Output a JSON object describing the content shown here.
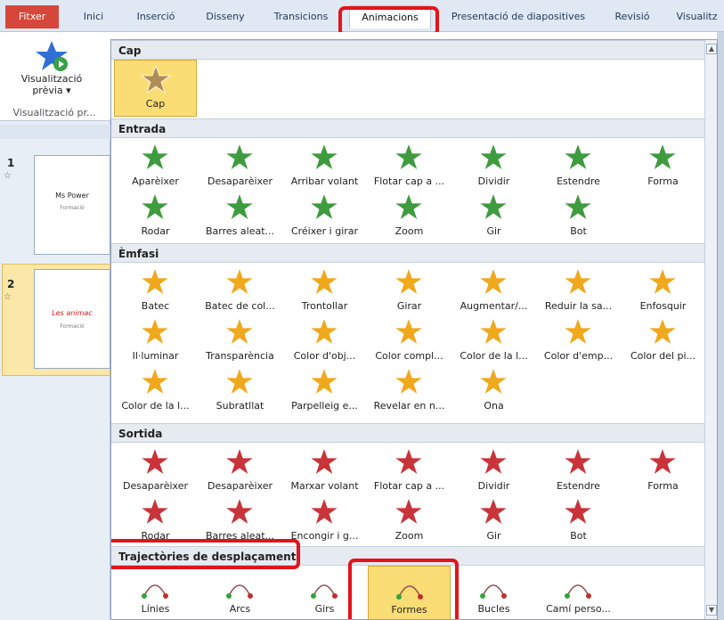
{
  "tabs": [
    "Fitxer",
    "Inici",
    "Inserció",
    "Disseny",
    "Transicions",
    "Animacions",
    "Presentació de diapositives",
    "Revisió",
    "Visualitz"
  ],
  "ribbon": {
    "preview_line1": "Visualització",
    "preview_line2": "prèvia ▾",
    "group": "Visualització pr..."
  },
  "slides": [
    {
      "num": "1",
      "title": "Ms Power",
      "sub": "Formació"
    },
    {
      "num": "2",
      "title": "Les animac",
      "sub": "Formació"
    }
  ],
  "sections": {
    "cap": "Cap",
    "entrada": "Entrada",
    "emfasi": "Èmfasi",
    "sortida": "Sortida",
    "trajectories": "Trajectòries de desplaçament"
  },
  "items": {
    "cap": [
      "Cap"
    ],
    "entrada": [
      "Aparèixer",
      "Desaparèixer",
      "Arribar volant",
      "Flotar cap a ...",
      "Dividir",
      "Estendre",
      "Forma",
      "Rodar",
      "Barres aleat...",
      "Créixer i girar",
      "Zoom",
      "Gir",
      "Bot"
    ],
    "emfasi": [
      "Batec",
      "Batec de col...",
      "Trontollar",
      "Girar",
      "Augmentar/...",
      "Reduir la sa...",
      "Enfosquir",
      "Il·luminar",
      "Transparència",
      "Color d'obj...",
      "Color compl...",
      "Color de la l...",
      "Color d'emp...",
      "Color del pi...",
      "Color de la l...",
      "Subratllat",
      "Parpelleig e...",
      "Revelar en n...",
      "Ona"
    ],
    "sortida": [
      "Desaparèixer",
      "Desaparèixer",
      "Marxar volant",
      "Flotar cap a ...",
      "Dividir",
      "Estendre",
      "Forma",
      "Rodar",
      "Barres aleat...",
      "Encongir i g...",
      "Zoom",
      "Gir",
      "Bot"
    ],
    "trajectories": [
      "Línies",
      "Arcs",
      "Girs",
      "Formes",
      "Bucles",
      "Camí perso..."
    ]
  },
  "colors": {
    "entrada": "#3f9b3f",
    "emfasi": "#f0a81c",
    "sortida": "#c9343a",
    "selected": "#fbdd75"
  }
}
